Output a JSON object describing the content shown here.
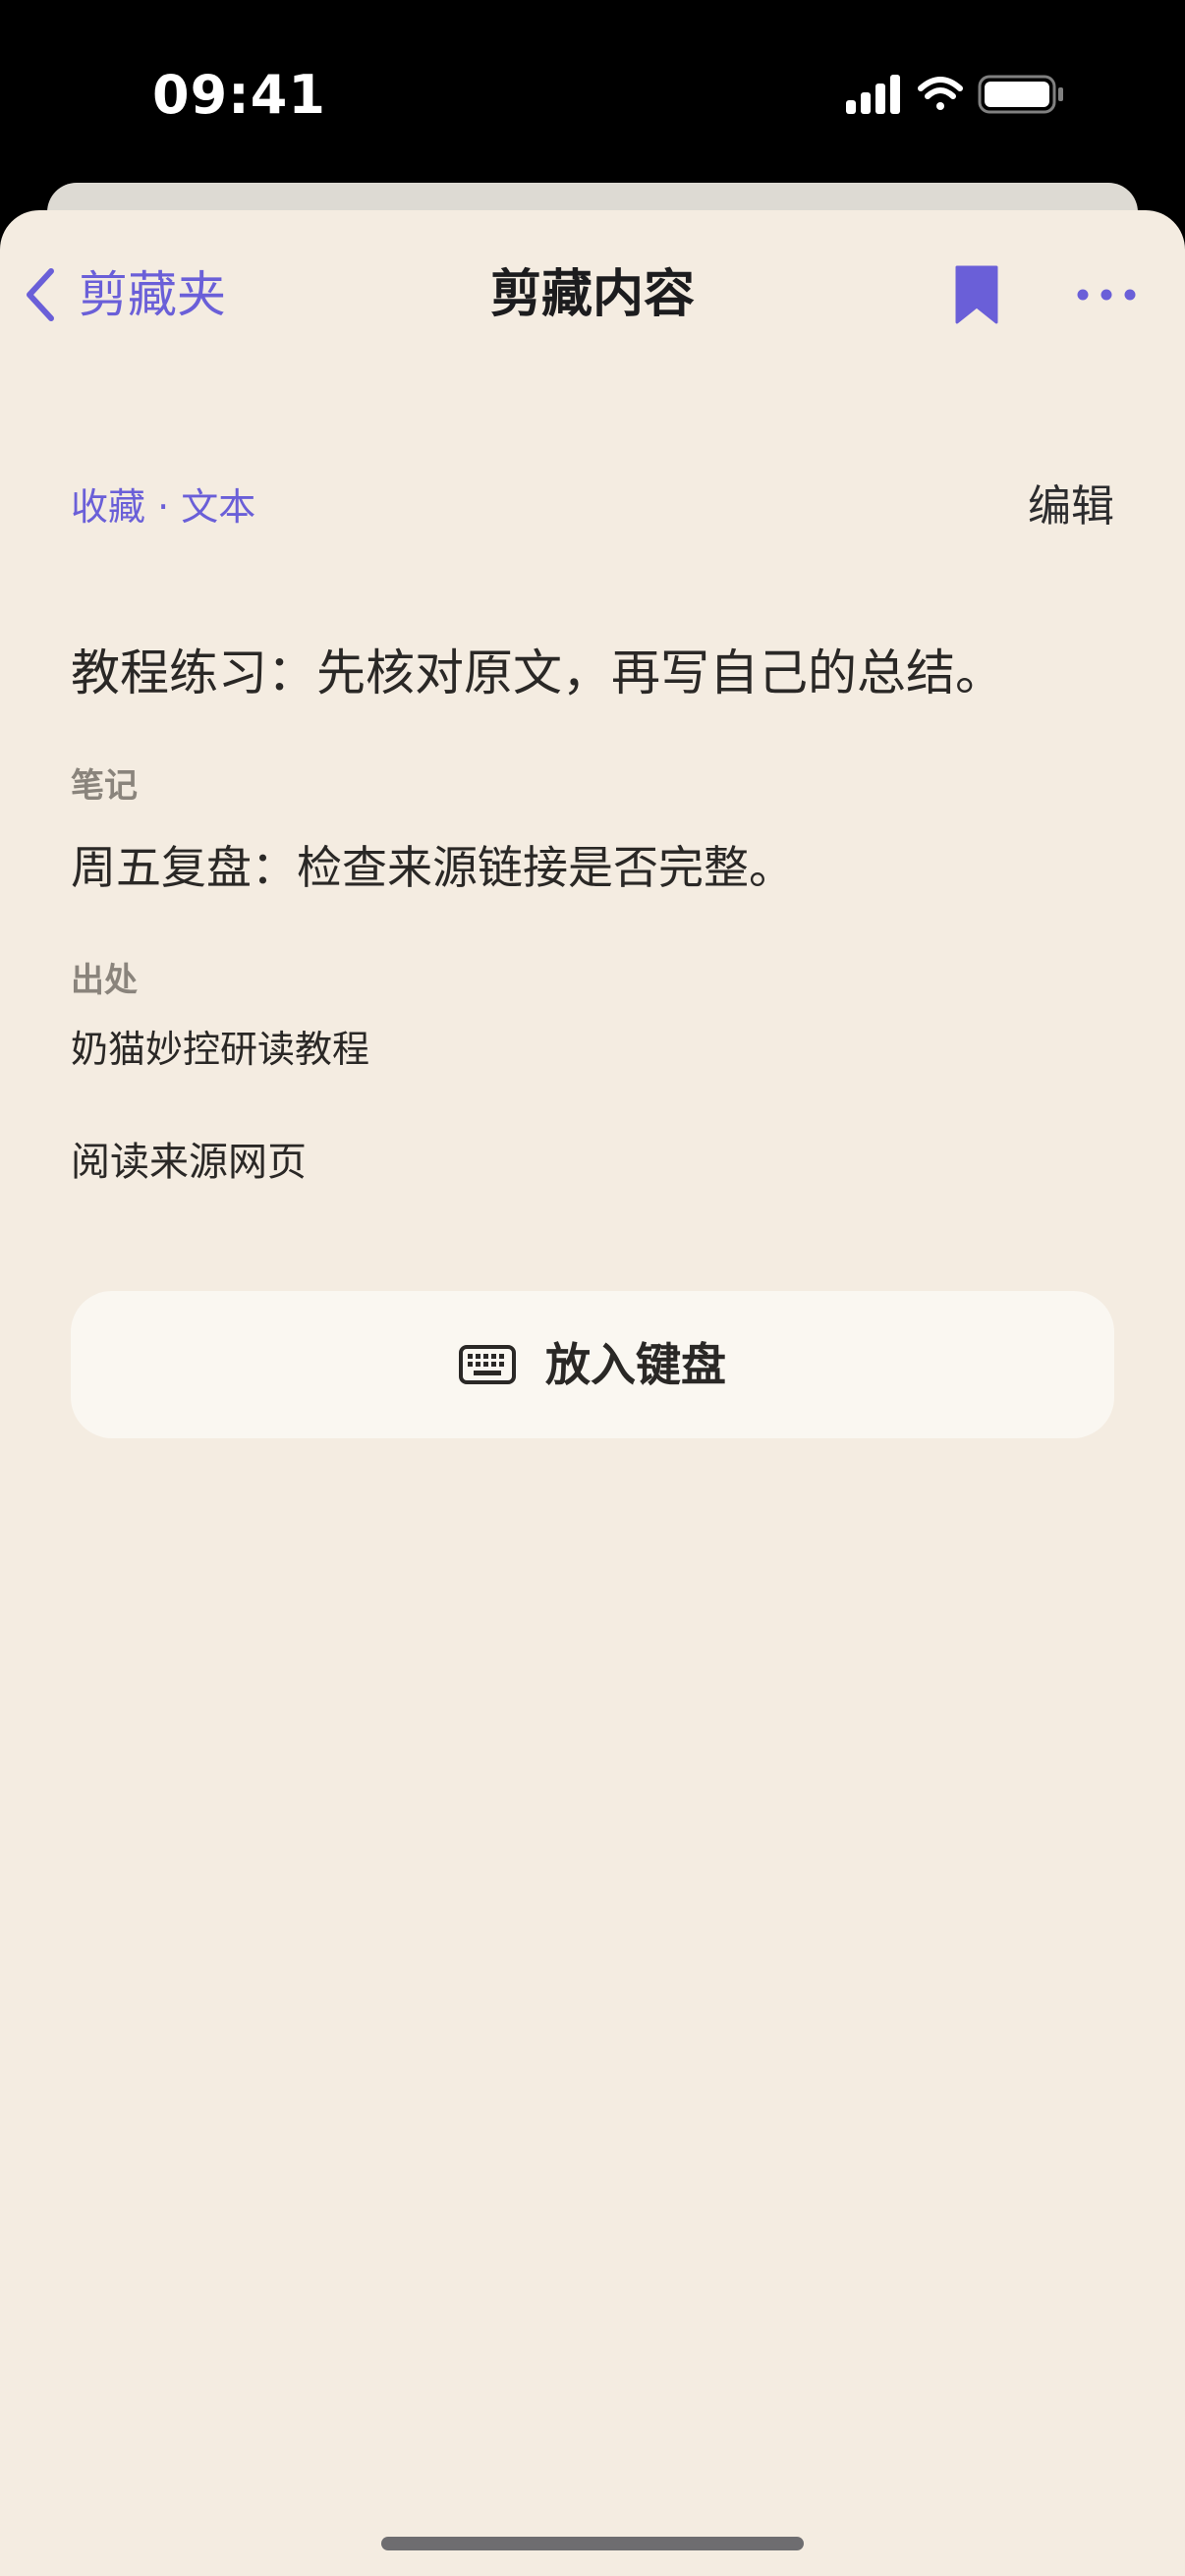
{
  "status_bar": {
    "time": "09:41",
    "icons": [
      "cellular-signal-icon",
      "wifi-icon",
      "battery-icon"
    ]
  },
  "nav": {
    "back_label": "剪藏夹",
    "title": "剪藏内容",
    "back_icon": "chevron-left-icon",
    "bookmark_icon": "bookmark-icon",
    "more_icon": "ellipsis-icon"
  },
  "clip": {
    "category": "收藏 · 文本",
    "edit_label": "编辑",
    "text": "教程练习：先核对原文，再写自己的总结。",
    "note_label": "笔记",
    "note": "周五复盘：检查来源链接是否完整。",
    "source_label": "出处",
    "source": "奶猫妙控研读教程",
    "read_source_label": "阅读来源网页"
  },
  "actions": {
    "keyboard_label": "放入键盘",
    "keyboard_icon": "keyboard-icon"
  },
  "colors": {
    "accent": "#6a5fd8",
    "background": "#f4ece1",
    "card": "#faf7f1",
    "text": "#2a2826",
    "secondary_text": "#8a847c"
  }
}
